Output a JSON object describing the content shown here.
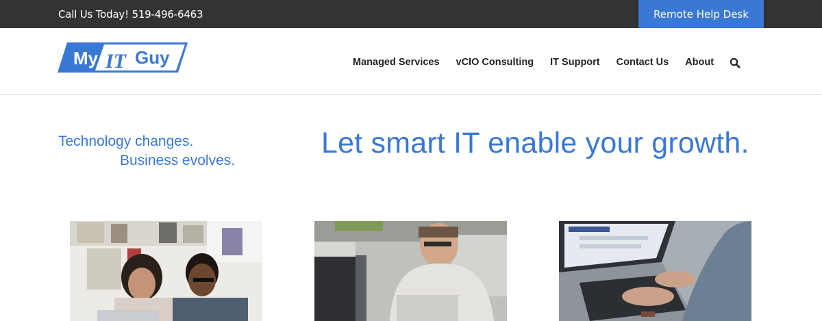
{
  "topbar": {
    "phone_text": "Call Us Today! 519-496-6463",
    "remote_button": "Remote Help Desk"
  },
  "logo": {
    "text_my": "My",
    "text_it": "IT",
    "text_guy": "Guy"
  },
  "nav": {
    "items": [
      "Managed Services",
      "vCIO Consulting",
      "IT Support",
      "Contact Us",
      "About"
    ]
  },
  "hero": {
    "tagline_line1": "Technology changes.",
    "tagline_line2": "Business evolves.",
    "headline": "Let smart IT enable your growth."
  },
  "colors": {
    "accent": "#3a78d6",
    "topbar": "#333333",
    "nav_text": "#222222"
  }
}
